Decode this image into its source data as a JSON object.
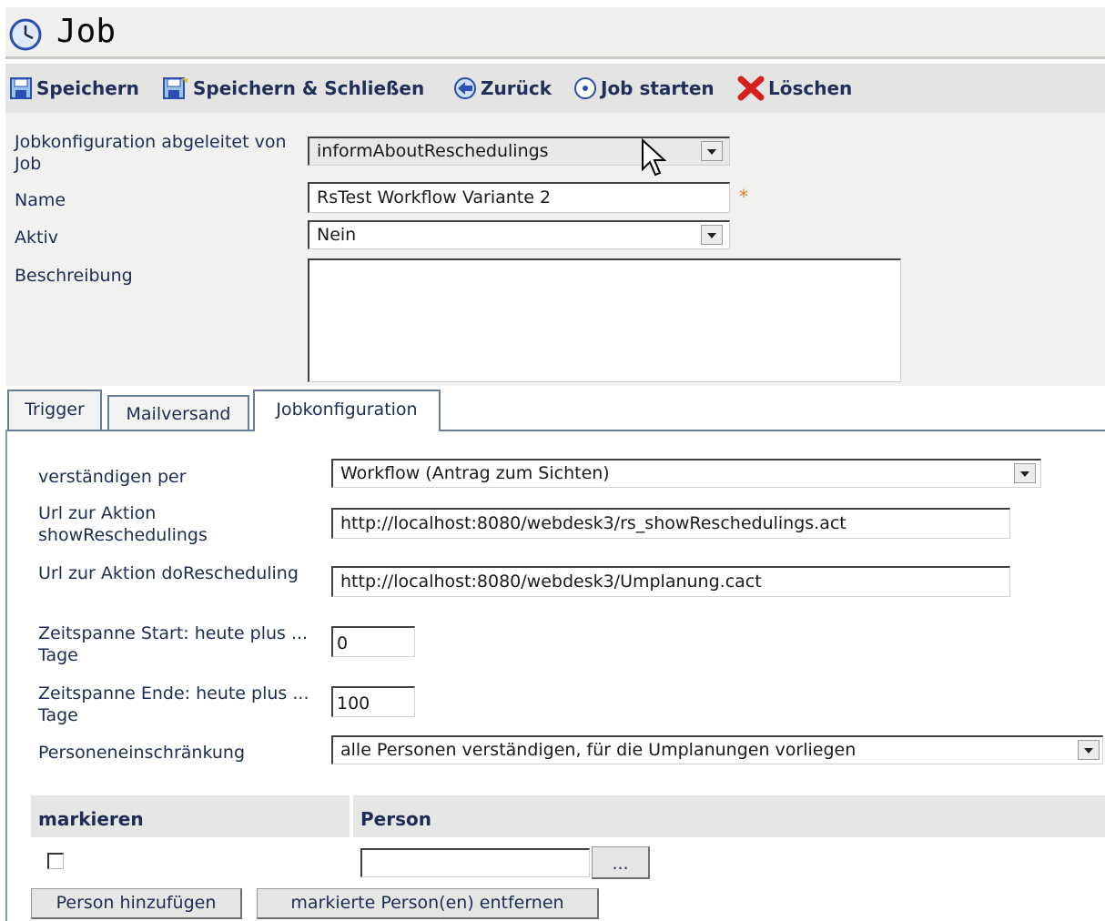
{
  "window": {
    "title": "Job"
  },
  "toolbar": {
    "save": "Speichern",
    "save_close": "Speichern & Schließen",
    "back": "Zurück",
    "start_job": "Job starten",
    "delete": "Löschen"
  },
  "form": {
    "derived_label": "Jobkonfiguration abgeleitet von Job",
    "derived_value": "informAboutReschedulings",
    "name_label": "Name",
    "name_value": "RsTest Workflow Variante 2",
    "required_marker": "*",
    "active_label": "Aktiv",
    "active_value": "Nein",
    "description_label": "Beschreibung",
    "description_value": ""
  },
  "tabs": [
    {
      "label": "Trigger"
    },
    {
      "label": "Mailversand"
    },
    {
      "label": "Jobkonfiguration",
      "active": true
    }
  ],
  "config": {
    "notify_label": "verständigen per",
    "notify_value": "Workflow (Antrag zum Sichten)",
    "url_show_label": "Url zur Aktion showReschedulings",
    "url_show_value": "http://localhost:8080/webdesk3/rs_showReschedulings.act",
    "url_do_label": "Url zur Aktion doRescheduling",
    "url_do_value": "http://localhost:8080/webdesk3/Umplanung.cact",
    "start_label": "Zeitspanne Start: heute plus ... Tage",
    "start_value": "0",
    "end_label": "Zeitspanne Ende: heute plus ... Tage",
    "end_value": "100",
    "restriction_label": "Personeneinschränkung",
    "restriction_value": "alle Personen verständigen, für die Umplanungen vorliegen"
  },
  "persons_table": {
    "col_mark": "markieren",
    "col_person": "Person",
    "row_person_value": "",
    "browse_label": "...",
    "add_button": "Person hinzufügen",
    "remove_button": "markierte Person(en) entfernen"
  },
  "colors": {
    "accent": "#1f2f5a",
    "required": "#e87b1e",
    "delete_icon": "#d42020"
  }
}
